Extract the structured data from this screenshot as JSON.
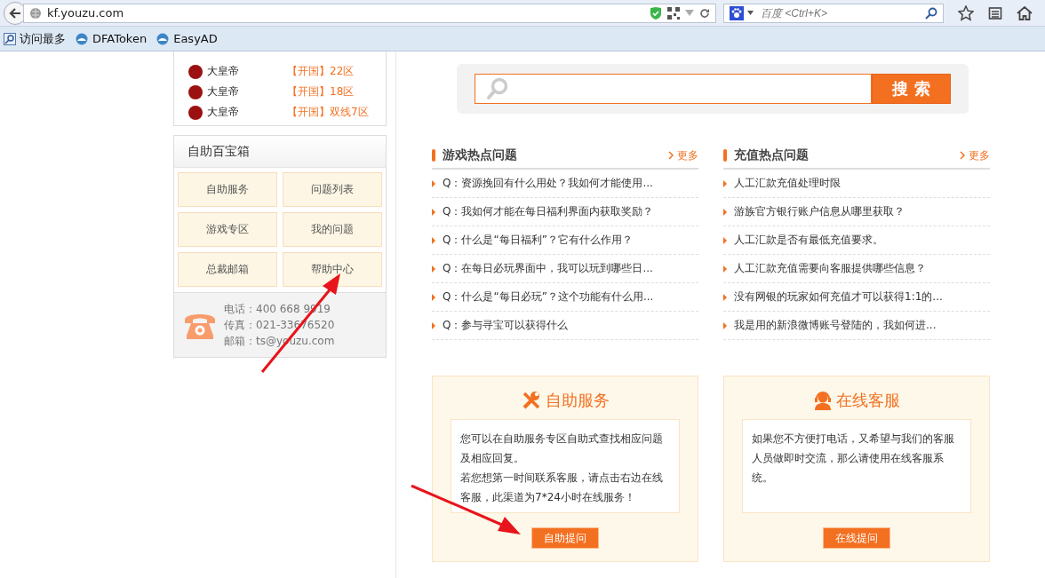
{
  "browser": {
    "url": "kf.youzu.com",
    "search_placeholder": "百度 <Ctrl+K>",
    "bookmarks": [
      "访问最多",
      "DFAToken",
      "EasyAD"
    ]
  },
  "server_list": [
    {
      "name": "大皇帝",
      "server": "【开国】22区"
    },
    {
      "name": "大皇帝",
      "server": "【开国】18区"
    },
    {
      "name": "大皇帝",
      "server": "【开国】双线7区"
    }
  ],
  "toolbox": {
    "title": "自助百宝箱",
    "buttons": [
      "自助服务",
      "问题列表",
      "游戏专区",
      "我的问题",
      "总裁邮箱",
      "帮助中心"
    ],
    "contact": [
      "电话：400 668 9919",
      "传真：021-33676520",
      "邮箱：ts@youzu.com"
    ]
  },
  "search": {
    "button": "搜 索"
  },
  "hot_lists": [
    {
      "title": "游戏热点问题",
      "more": "更多",
      "items": [
        "Q：资源挽回有什么用处？我如何才能使用...",
        "Q：我如何才能在每日福利界面内获取奖励？",
        "Q：什么是“每日福利”？它有什么作用？",
        "Q：在每日必玩界面中，我可以玩到哪些日...",
        "Q：什么是“每日必玩”？这个功能有什么用...",
        "Q：参与寻宝可以获得什么"
      ]
    },
    {
      "title": "充值热点问题",
      "more": "更多",
      "items": [
        "人工汇款充值处理时限",
        "游族官方银行账户信息从哪里获取？",
        "人工汇款是否有最低充值要求。",
        "人工汇款充值需要向客服提供哪些信息？",
        "没有网银的玩家如何充值才可以获得1:1的...",
        "我是用的新浪微博账号登陆的，我如何进..."
      ]
    }
  ],
  "service_cards": [
    {
      "kind": "self",
      "title": "自助服务",
      "paragraphs": [
        "您可以在自助服务专区自助式查找相应问题及相应回复。",
        "若您想第一时间联系客服，请点击右边在线客服，此渠道为7*24小时在线服务！"
      ],
      "button": "自助提问"
    },
    {
      "kind": "online",
      "title": "在线客服",
      "paragraphs": [
        "如果您不方便打电话，又希望与我们的客服人员做即时交流，那么请使用在线客服系统。"
      ],
      "button": "在线提问"
    }
  ]
}
